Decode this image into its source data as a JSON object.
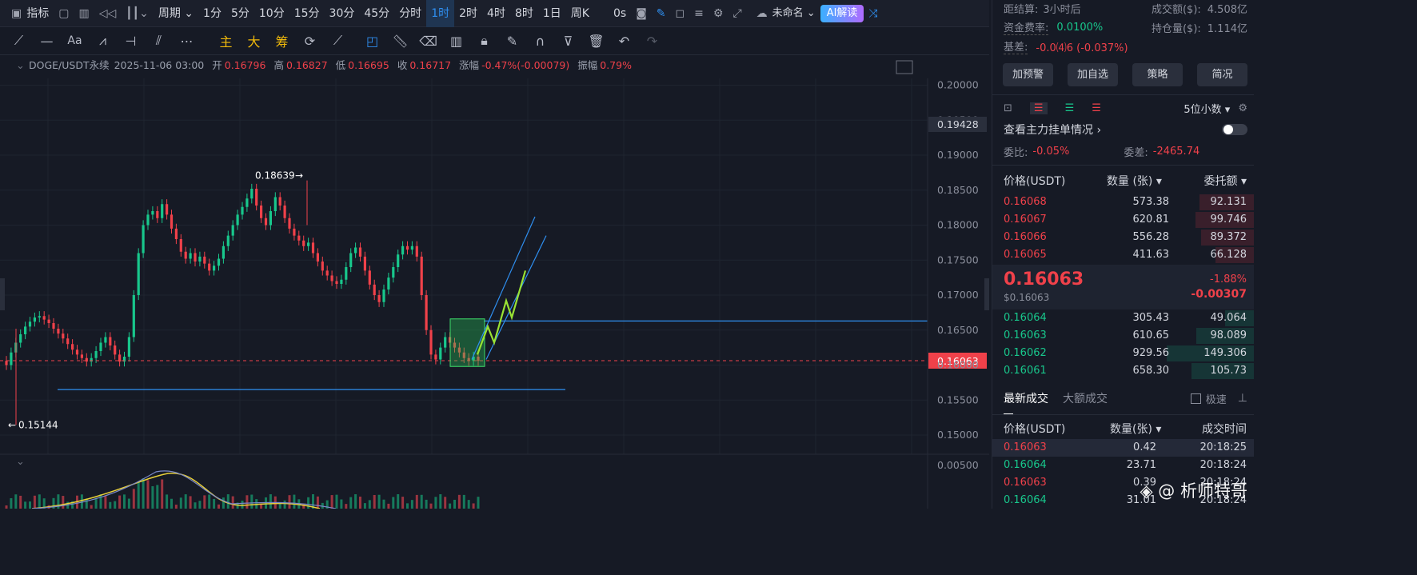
{
  "toolbar": {
    "indicator": "指标",
    "period": "周期",
    "timeframes": [
      "1分",
      "5分",
      "10分",
      "15分",
      "30分",
      "45分",
      "分时",
      "1时",
      "2时",
      "4时",
      "8时",
      "1日",
      "周K"
    ],
    "active_timeframe": "1时",
    "countdown": "0s",
    "layout_name": "未命名",
    "ai_button": "AI解读"
  },
  "drawtools": {
    "main": "主",
    "big": "大",
    "chips": "筹"
  },
  "info": {
    "symbol": "DOGE/USDT永续",
    "datetime": "2025-11-06 03:00",
    "open_label": "开",
    "open": "0.16796",
    "high_label": "高",
    "high": "0.16827",
    "low_label": "低",
    "low": "0.16695",
    "close_label": "收",
    "close": "0.16717",
    "chg_label": "涨幅",
    "chg": "-0.47%(-0.00079)",
    "amp_label": "振幅",
    "amp": "0.79%"
  },
  "chart_data": {
    "type": "candlestick",
    "symbol": "DOGE/USDT永续",
    "interval": "1时",
    "y_axis_ticks": [
      "0.20000",
      "0.19500",
      "0.19000",
      "0.18500",
      "0.18000",
      "0.17500",
      "0.17000",
      "0.16500",
      "0.16000",
      "0.15500",
      "0.15000"
    ],
    "ylim": [
      0.1485,
      0.201
    ],
    "current_price_tag": "0.16063",
    "marker_tag": "0.19428",
    "high_annotation": "0.18639",
    "low_annotation": "0.15144",
    "sub_axis_tick": "0.00500",
    "current_price": 0.16063,
    "support_line": 0.1565,
    "resistance_line": 0.1663,
    "consolidation_box": [
      0.1598,
      0.1666
    ],
    "closes": [
      0.16,
      0.1618,
      0.1632,
      0.1644,
      0.1655,
      0.1662,
      0.1668,
      0.167,
      0.1665,
      0.166,
      0.1652,
      0.1645,
      0.1638,
      0.163,
      0.1622,
      0.1615,
      0.161,
      0.1605,
      0.161,
      0.162,
      0.1632,
      0.164,
      0.1628,
      0.1615,
      0.1605,
      0.1612,
      0.164,
      0.17,
      0.176,
      0.18,
      0.1815,
      0.182,
      0.181,
      0.183,
      0.1815,
      0.1795,
      0.178,
      0.1762,
      0.1752,
      0.176,
      0.1748,
      0.1755,
      0.1745,
      0.1735,
      0.1742,
      0.1752,
      0.177,
      0.1785,
      0.18,
      0.1815,
      0.1826,
      0.1838,
      0.1852,
      0.1828,
      0.181,
      0.18,
      0.182,
      0.184,
      0.1828,
      0.181,
      0.1795,
      0.1785,
      0.1778,
      0.177,
      0.1775,
      0.176,
      0.1748,
      0.1735,
      0.1728,
      0.172,
      0.1716,
      0.1722,
      0.174,
      0.176,
      0.1768,
      0.1755,
      0.1735,
      0.1715,
      0.17,
      0.169,
      0.1708,
      0.1725,
      0.174,
      0.1758,
      0.177,
      0.1765,
      0.177,
      0.1755,
      0.17,
      0.165,
      0.1615,
      0.1608,
      0.1625,
      0.164,
      0.1632,
      0.1625,
      0.1618,
      0.161,
      0.1606,
      0.1612,
      0.1606
    ]
  },
  "right": {
    "settle_label": "距结算:",
    "settle": "3小时后",
    "turnover_label": "成交额($):",
    "turnover": "4.508亿",
    "funding_label": "资金费率:",
    "funding": "0.0100%",
    "oi_label": "持仓量($):",
    "oi": "1.114亿",
    "basis_label": "基差:",
    "basis": "-0.0⑷6 (-0.037%)",
    "buttons": [
      "加预警",
      "加自选",
      "策略",
      "简况"
    ],
    "decimals": "5位小数",
    "depth_link": "查看主力挂单情况",
    "ratio_label": "委比:",
    "ratio": "-0.05%",
    "diff_label": "委差:",
    "diff": "-2465.74",
    "ob_headers": [
      "价格(USDT)",
      "数量 (张)",
      "委托额"
    ],
    "asks": [
      [
        "0.16068",
        "573.38",
        "92.131"
      ],
      [
        "0.16067",
        "620.81",
        "99.746"
      ],
      [
        "0.16066",
        "556.28",
        "89.372"
      ],
      [
        "0.16065",
        "411.63",
        "66.128"
      ]
    ],
    "last_price": "0.16063",
    "last_usd": "$0.16063",
    "chg_pct": "-1.88%",
    "chg_abs": "-0.00307",
    "bids": [
      [
        "0.16064",
        "305.43",
        "49.064"
      ],
      [
        "0.16063",
        "610.65",
        "98.089"
      ],
      [
        "0.16062",
        "929.56",
        "149.306"
      ],
      [
        "0.16061",
        "658.30",
        "105.73"
      ]
    ],
    "trade_tabs": [
      "最新成交",
      "大额成交"
    ],
    "fast_label": "极速",
    "trade_headers": [
      "价格(USDT)",
      "数量(张)",
      "成交时间"
    ],
    "trades": [
      [
        "0.16063",
        "0.42",
        "20:18:25"
      ],
      [
        "0.16064",
        "23.71",
        "20:18:24"
      ],
      [
        "0.16063",
        "0.39",
        "20:18:24"
      ],
      [
        "0.16064",
        "31.01",
        "20:18:24"
      ]
    ],
    "watermark": "析师特哥"
  },
  "colors": {
    "up": "#18c78c",
    "down": "#f0414a",
    "accent": "#2f8ff0",
    "bg": "#161a25"
  }
}
